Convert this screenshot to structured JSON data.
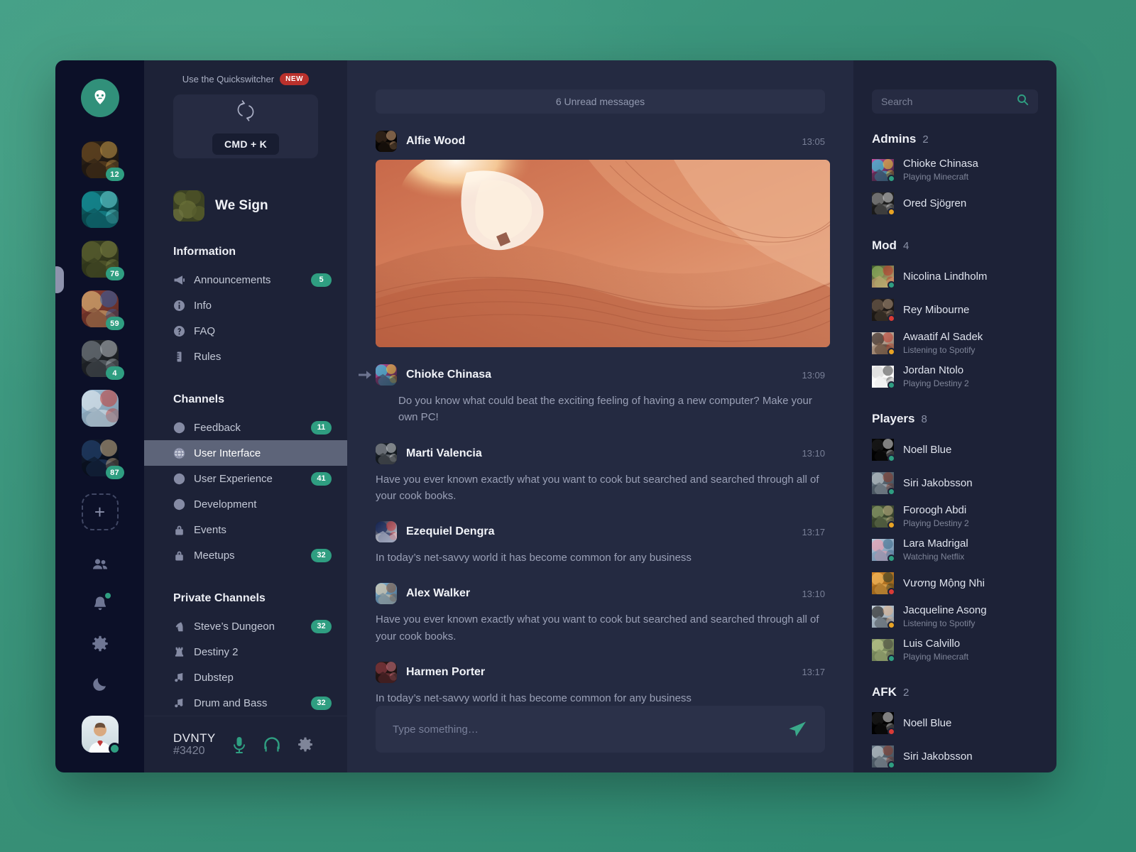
{
  "theme": {
    "accent": "#2f9e81",
    "badge_new": "#b9312c",
    "desktop_bg": "#389077",
    "window_bg": "#242a41",
    "sidebar_bg": "#1d2237",
    "rail_bg": "#0c1028",
    "status_online": "#2f9e81",
    "status_idle": "#e8a324",
    "status_dnd": "#d93b36"
  },
  "server_rail": {
    "logo_icon": "goat-logo-icon",
    "servers": [
      {
        "icon": "server-thumb-bar",
        "badge": "12"
      },
      {
        "icon": "server-thumb-jellyfish",
        "badge": ""
      },
      {
        "icon": "server-thumb-moss",
        "badge": "76"
      },
      {
        "icon": "server-thumb-shop",
        "badge": "59"
      },
      {
        "icon": "server-thumb-snow",
        "badge": "4"
      },
      {
        "icon": "server-thumb-london",
        "badge": ""
      },
      {
        "icon": "server-thumb-night",
        "badge": "87"
      }
    ],
    "add_label": "+",
    "tools": [
      {
        "name": "friends-icon",
        "has_dot": false
      },
      {
        "name": "notifications-icon",
        "has_dot": true
      },
      {
        "name": "settings-icon",
        "has_dot": false
      },
      {
        "name": "dark-mode-icon",
        "has_dot": false
      }
    ]
  },
  "sidebar": {
    "quickswitcher": {
      "label": "Use the Quickswitcher",
      "badge": "NEW",
      "icon": "sync-arrows-icon",
      "shortcut": "CMD + K"
    },
    "server": {
      "name": "We Sign",
      "icon": "server-thumb-moss"
    },
    "sections": [
      {
        "title": "Information",
        "items": [
          {
            "label": "Announcements",
            "icon": "megaphone-icon",
            "badge": "5",
            "active": false
          },
          {
            "label": "Info",
            "icon": "info-icon",
            "badge": "",
            "active": false
          },
          {
            "label": "FAQ",
            "icon": "question-icon",
            "badge": "",
            "active": false
          },
          {
            "label": "Rules",
            "icon": "ruler-icon",
            "badge": "",
            "active": false
          }
        ]
      },
      {
        "title": "Channels",
        "items": [
          {
            "label": "Feedback",
            "icon": "globe-icon",
            "badge": "11",
            "active": false
          },
          {
            "label": "User Interface",
            "icon": "globe-icon",
            "badge": "",
            "active": true
          },
          {
            "label": "User Experience",
            "icon": "globe-icon",
            "badge": "41",
            "active": false
          },
          {
            "label": "Development",
            "icon": "globe-icon",
            "badge": "",
            "active": false
          },
          {
            "label": "Events",
            "icon": "lock-icon",
            "badge": "",
            "active": false
          },
          {
            "label": "Meetups",
            "icon": "lock-icon",
            "badge": "32",
            "active": false
          }
        ]
      },
      {
        "title": "Private Channels",
        "items": [
          {
            "label": "Steve’s Dungeon",
            "icon": "knight-icon",
            "badge": "32",
            "active": false
          },
          {
            "label": "Destiny 2",
            "icon": "rook-icon",
            "badge": "",
            "active": false
          },
          {
            "label": "Dubstep",
            "icon": "music-icon",
            "badge": "",
            "active": false
          },
          {
            "label": "Drum and Bass",
            "icon": "music-icon",
            "badge": "32",
            "active": false
          }
        ]
      }
    ],
    "footer": {
      "username": "DVNTY",
      "discriminator": "#3420",
      "mic_icon": "microphone-icon",
      "headphones_icon": "headphones-icon",
      "settings_icon": "gear-icon"
    }
  },
  "chat": {
    "unread_banner": "6 Unread messages",
    "messages": [
      {
        "author": "Alfie Wood",
        "time": "13:05",
        "avatar": "avatar-alfie",
        "text": "",
        "image": "antelope-canyon-photo",
        "reply": false,
        "indent": false
      },
      {
        "author": "Chioke Chinasa",
        "time": "13:09",
        "avatar": "avatar-chioke",
        "text": "Do you know what could beat the exciting feeling of having a new computer? Make your own PC!",
        "image": "",
        "reply": true,
        "indent": true
      },
      {
        "author": "Marti Valencia",
        "time": "13:10",
        "avatar": "avatar-marti",
        "text": "Have you ever known exactly what you want to cook but searched and searched through all of your cook books.",
        "image": "",
        "reply": false,
        "indent": false
      },
      {
        "author": "Ezequiel Dengra",
        "time": "13:17",
        "avatar": "avatar-ezequiel",
        "text": "In today’s net-savvy world it has become common for any business",
        "image": "",
        "reply": false,
        "indent": false
      },
      {
        "author": "Alex Walker",
        "time": "13:10",
        "avatar": "avatar-alex",
        "text": "Have you ever known exactly what you want to cook but searched and searched through all of your cook books.",
        "image": "",
        "reply": false,
        "indent": false
      },
      {
        "author": "Harmen Porter",
        "time": "13:17",
        "avatar": "avatar-harmen",
        "text": "In today’s net-savvy world it has become common for any business",
        "image": "",
        "reply": false,
        "indent": false
      }
    ],
    "composer": {
      "placeholder": "Type something…",
      "value": "",
      "send_icon": "send-paper-plane-icon"
    }
  },
  "members": {
    "search": {
      "placeholder": "Search",
      "value": "",
      "icon": "search-icon"
    },
    "groups": [
      {
        "title": "Admins",
        "count": "2",
        "members": [
          {
            "name": "Chioke Chinasa",
            "activity": "Playing Minecraft",
            "status": "online",
            "avatar": "avatar-chioke"
          },
          {
            "name": "Ored Sjögren",
            "activity": "",
            "status": "idle",
            "avatar": "avatar-ored"
          }
        ]
      },
      {
        "title": "Mod",
        "count": "4",
        "members": [
          {
            "name": "Nicolina Lindholm",
            "activity": "",
            "status": "online",
            "avatar": "avatar-nicolina"
          },
          {
            "name": "Rey Mibourne",
            "activity": "",
            "status": "dnd",
            "avatar": "avatar-rey"
          },
          {
            "name": "Awaatif Al Sadek",
            "activity": "Listening to Spotify",
            "status": "idle",
            "avatar": "avatar-awaatif"
          },
          {
            "name": "Jordan Ntolo",
            "activity": "Playing Destiny 2",
            "status": "online",
            "avatar": "avatar-jordan"
          }
        ]
      },
      {
        "title": "Players",
        "count": "8",
        "members": [
          {
            "name": "Noell Blue",
            "activity": "",
            "status": "online",
            "avatar": "avatar-noell"
          },
          {
            "name": "Siri Jakobsson",
            "activity": "",
            "status": "online",
            "avatar": "avatar-siri"
          },
          {
            "name": "Foroogh Abdi",
            "activity": "Playing Destiny 2",
            "status": "idle",
            "avatar": "avatar-foroogh"
          },
          {
            "name": "Lara Madrigal",
            "activity": "Watching Netflix",
            "status": "online",
            "avatar": "avatar-lara"
          },
          {
            "name": "Vương Mộng Nhi",
            "activity": "",
            "status": "dnd",
            "avatar": "avatar-vuong"
          },
          {
            "name": "Jacqueline Asong",
            "activity": "Listening to Spotify",
            "status": "idle",
            "avatar": "avatar-jacqueline"
          },
          {
            "name": "Luis Calvillo",
            "activity": "Playing Minecraft",
            "status": "online",
            "avatar": "avatar-luis"
          }
        ]
      },
      {
        "title": "AFK",
        "count": "2",
        "members": [
          {
            "name": "Noell Blue",
            "activity": "",
            "status": "dnd",
            "avatar": "avatar-noell"
          },
          {
            "name": "Siri Jakobsson",
            "activity": "",
            "status": "online",
            "avatar": "avatar-siri"
          }
        ]
      }
    ]
  }
}
